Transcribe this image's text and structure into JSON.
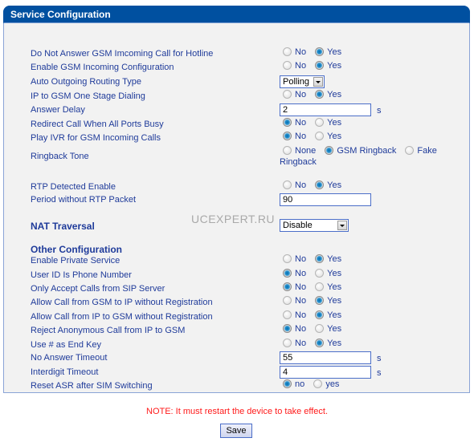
{
  "panel": {
    "title": "Service Configuration"
  },
  "watermark": "UCEXPERT.RU",
  "rows": {
    "r0": {
      "label": "Do Not Answer GSM Imcoming Call for Hotline",
      "options": [
        "No",
        "Yes"
      ],
      "selected": "Yes"
    },
    "r1": {
      "label": "Enable GSM Incoming Configuration",
      "options": [
        "No",
        "Yes"
      ],
      "selected": "Yes"
    },
    "r2": {
      "label": "Auto Outgoing Routing Type",
      "value": "Polling"
    },
    "r3": {
      "label": "IP to GSM One Stage Dialing",
      "options": [
        "No",
        "Yes"
      ],
      "selected": "Yes"
    },
    "r4": {
      "label": "Answer Delay",
      "value": "2",
      "unit": "s"
    },
    "r5": {
      "label": "Redirect Call When All Ports Busy",
      "options": [
        "No",
        "Yes"
      ],
      "selected": "No"
    },
    "r6": {
      "label": "Play IVR for GSM Incoming Calls",
      "options": [
        "No",
        "Yes"
      ],
      "selected": "No"
    },
    "r7": {
      "label": "Ringback Tone",
      "options": [
        "None",
        "GSM Ringback",
        "Fake"
      ],
      "option_wrap": "Ringback",
      "selected": "GSM Ringback"
    },
    "r8": {
      "label": "RTP Detected Enable",
      "options": [
        "No",
        "Yes"
      ],
      "selected": "Yes"
    },
    "r9": {
      "label": "Period without RTP Packet",
      "value": "90"
    },
    "nat": {
      "label": "NAT Traversal",
      "value": "Disable"
    },
    "other_heading": "Other Configuration",
    "o0": {
      "label": "Enable Private Service",
      "options": [
        "No",
        "Yes"
      ],
      "selected": "Yes"
    },
    "o1": {
      "label": "User ID Is Phone Number",
      "options": [
        "No",
        "Yes"
      ],
      "selected": "No"
    },
    "o2": {
      "label": "Only Accept Calls from SIP Server",
      "options": [
        "No",
        "Yes"
      ],
      "selected": "No"
    },
    "o3": {
      "label": "Allow Call from GSM to IP without Registration",
      "options": [
        "No",
        "Yes"
      ],
      "selected": "Yes"
    },
    "o4": {
      "label": "Allow Call from IP to GSM without Registration",
      "options": [
        "No",
        "Yes"
      ],
      "selected": "Yes"
    },
    "o5": {
      "label": "Reject Anonymous Call from IP to GSM",
      "options": [
        "No",
        "Yes"
      ],
      "selected": "No"
    },
    "o6": {
      "label": "Use # as End Key",
      "options": [
        "No",
        "Yes"
      ],
      "selected": "Yes"
    },
    "o7": {
      "label": "No Answer Timeout",
      "value": "55",
      "unit": "s"
    },
    "o8": {
      "label": "Interdigit Timeout",
      "value": "4",
      "unit": "s"
    },
    "o9": {
      "label": "Reset ASR after SIM Switching",
      "options": [
        "no",
        "yes"
      ],
      "selected": "no"
    }
  },
  "note": "NOTE: It must restart the device to take effect.",
  "save_label": "Save"
}
